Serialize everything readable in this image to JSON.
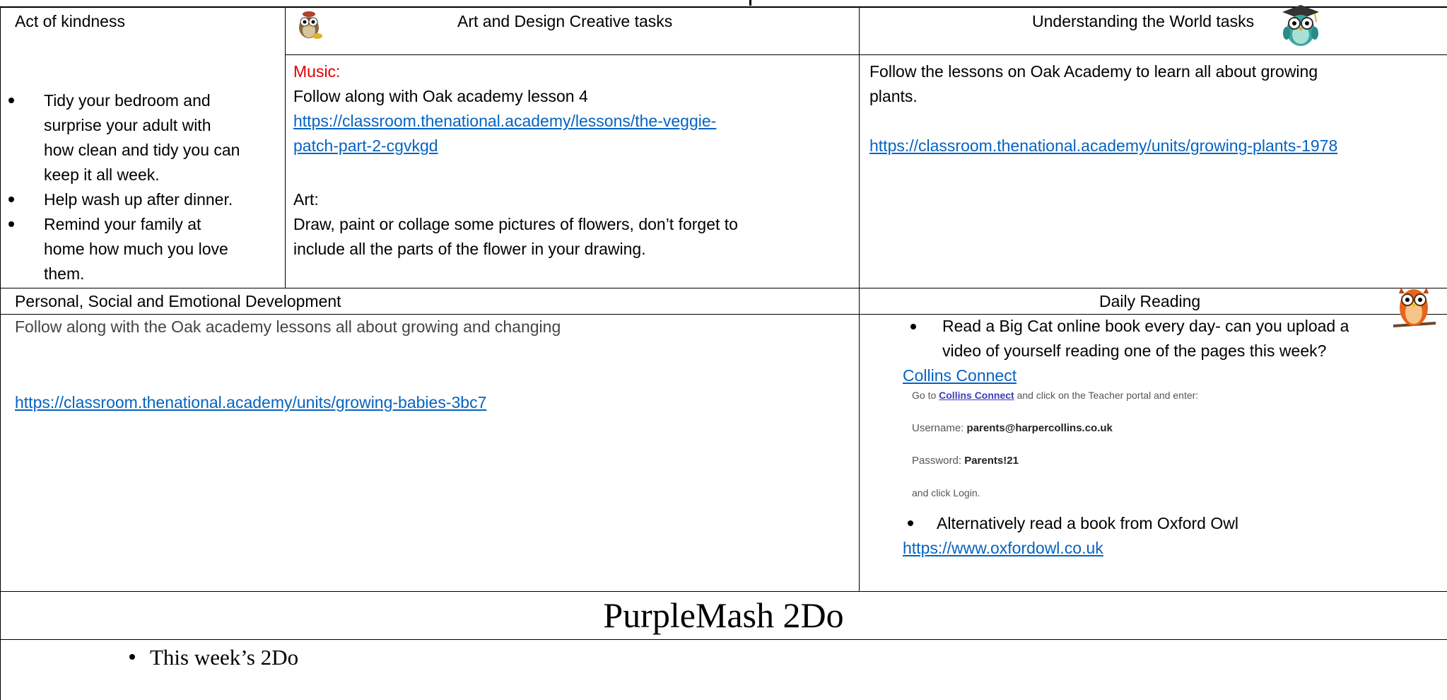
{
  "act_of_kindness": {
    "title": "Act of kindness",
    "items": [
      [
        "Tidy your bedroom and",
        "surprise your adult with",
        "how clean and tidy you can",
        "keep it all week."
      ],
      [
        "Help wash up after dinner."
      ],
      [
        "Remind your family at",
        "home how much you love",
        "them."
      ]
    ]
  },
  "art_design": {
    "title": "Art and Design Creative tasks",
    "music_label": "Music:",
    "music_text": "Follow along with Oak academy lesson 4",
    "music_link_1": "https://classroom.thenational.academy/lessons/the-veggie-",
    "music_link_2": "patch-part-2-cgvkgd",
    "art_label": "Art:",
    "art_text_1": "Draw, paint or collage some pictures of flowers, don’t forget to",
    "art_text_2": "include all the parts of the flower in your drawing."
  },
  "understanding_world": {
    "title": "Understanding the World tasks",
    "text_1": "Follow the lessons on Oak Academy to learn all about growing",
    "text_2": "plants.",
    "link": "https://classroom.thenational.academy/units/growing-plants-1978"
  },
  "psed": {
    "title": "Personal, Social and Emotional Development",
    "text": "Follow along with the Oak academy lessons all about growing and changing",
    "link": "https://classroom.thenational.academy/units/growing-babies-3bc7"
  },
  "daily_reading": {
    "title": "Daily Reading",
    "item_1a": "Read a Big Cat online book every day- can you upload a",
    "item_1b": "video of yourself reading one of the pages this week?",
    "collins_link": "Collins Connect",
    "login_intro_pre": "Go to ",
    "login_intro_link": "Collins Connect",
    "login_intro_post": " and click on the Teacher portal and enter:",
    "username_label": "Username: ",
    "username_value": "parents@harpercollins.co.uk",
    "password_label": "Password: ",
    "password_value": "Parents!21",
    "login_outro": "and click Login.",
    "item_2": "Alternatively read a book from Oxford Owl",
    "oxford_link": "https://www.oxfordowl.co.uk"
  },
  "purplemash": {
    "title": "PurpleMash 2Do",
    "item": "This week’s 2Do"
  }
}
